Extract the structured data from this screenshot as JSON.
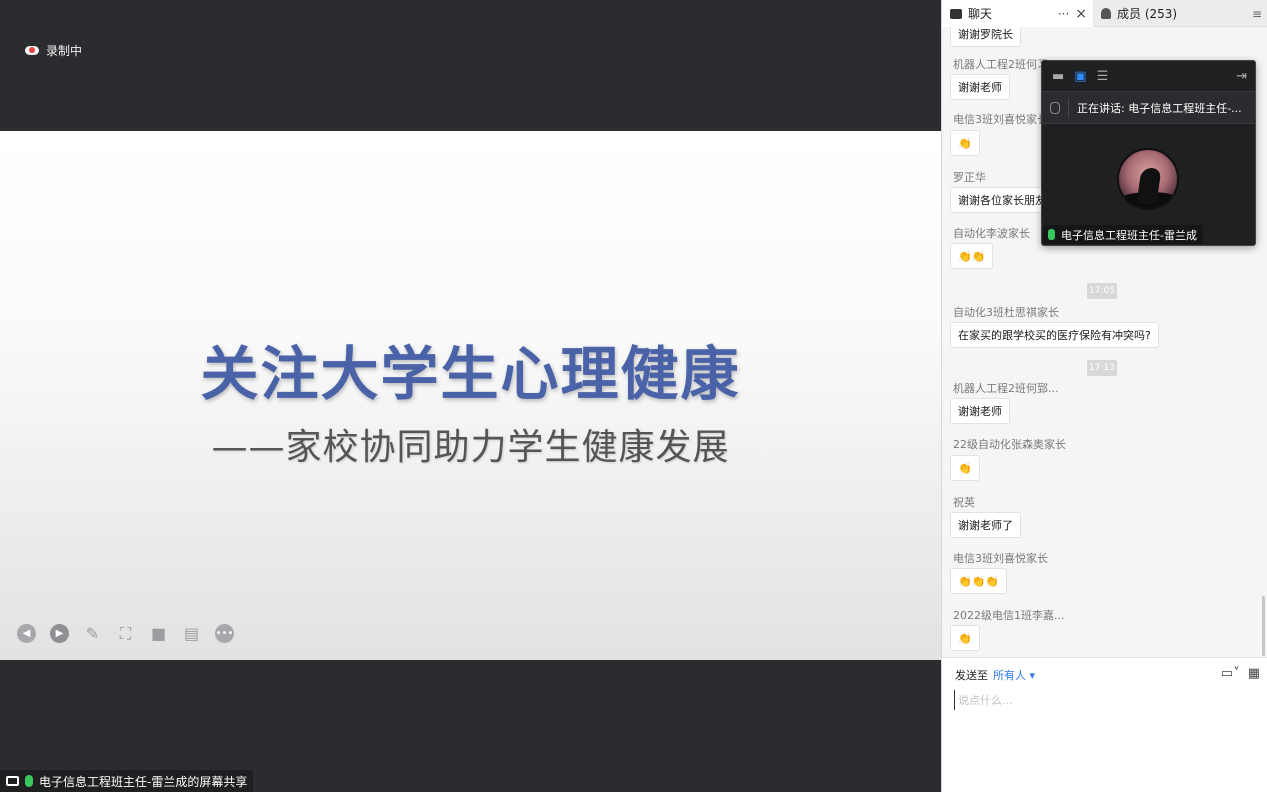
{
  "recording": {
    "label": "录制中"
  },
  "slide": {
    "title": "关注大学生心理健康",
    "subtitle": "——家校协同助力学生健康发展"
  },
  "share_label": "电子信息工程班主任-雷兰成的屏幕共享",
  "tabs": {
    "chat": "聊天",
    "chat_more": "···",
    "chat_close": "×",
    "members": "成员 (253)"
  },
  "messages": [
    {
      "sender": "",
      "text": "谢谢罗院长"
    },
    {
      "sender": "机器人工程2班何习",
      "text": "谢谢老师"
    },
    {
      "sender": "电信3班刘喜悦家长",
      "text": "👏"
    },
    {
      "sender": "罗正华",
      "text": "谢谢各位家长朋友"
    },
    {
      "sender": "自动化李波家长",
      "text": "👏👏"
    },
    {
      "time": "17:05"
    },
    {
      "sender": "自动化3班杜思祺家长",
      "text": "在家买的跟学校买的医疗保险有冲突吗?"
    },
    {
      "time": "17:13"
    },
    {
      "sender": "机器人工程2班何郅...",
      "text": "谢谢老师"
    },
    {
      "sender": "22级自动化张森奥家长",
      "text": "👏"
    },
    {
      "sender": "祝英",
      "text": "谢谢老师了"
    },
    {
      "sender": "电信3班刘喜悦家长",
      "text": "👏👏👏"
    },
    {
      "sender": "2022级电信1班李嘉...",
      "text": "👏"
    }
  ],
  "compose": {
    "send_to_label": "发送至",
    "audience": "所有人 ▾",
    "placeholder": "说点什么..."
  },
  "speaker_window": {
    "talking": "正在讲话: 电子信息工程班主任-...",
    "name": "电子信息工程班主任-雷兰成"
  }
}
